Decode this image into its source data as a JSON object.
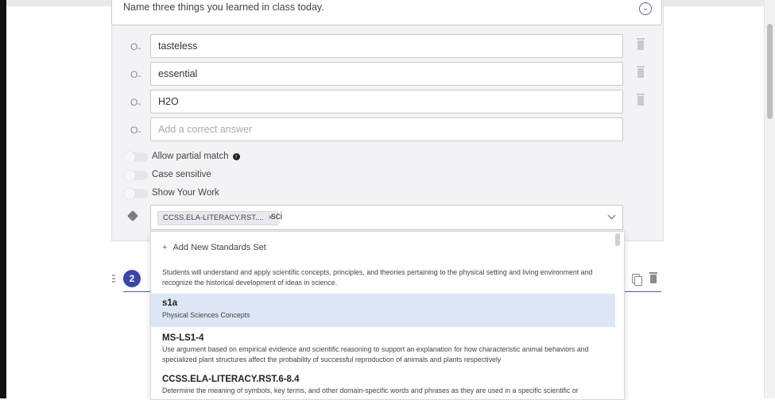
{
  "question": {
    "prompt_text": "Name three things you learned in class today.",
    "answers": [
      {
        "value": "tasteless"
      },
      {
        "value": "essential"
      },
      {
        "value": "H2O"
      }
    ],
    "new_answer_placeholder": "Add a correct answer",
    "options": [
      {
        "label": "Allow partial match",
        "enabled": false
      },
      {
        "label": "Case sensitive",
        "enabled": false
      },
      {
        "label": "Show Your Work",
        "enabled": false
      }
    ],
    "standards": {
      "selected_chip": "CCSS.ELA-LITERACY.RST....",
      "chip_remove_icon": "×",
      "search_query": "sci"
    }
  },
  "dropdown": {
    "add_new_label": "Add New Standards Set",
    "items": [
      {
        "code": "",
        "description": "Students will understand and apply scientific concepts, principles, and theories pertaining to the physical setting and living environment and recognize the historical development of ideas in science."
      },
      {
        "code": "s1a",
        "description": "Physical Sciences Concepts",
        "highlighted": true
      },
      {
        "code": "MS-LS1-4",
        "description": "Use argument based on empirical evidence and scientific reasoning to support an explanation for how characteristic animal behaviors and specialized plant structures affect the probability of successful reproduction of animals and plants respectively"
      },
      {
        "code": "CCSS.ELA-LITERACY.RST.6-8.4",
        "description": "Determine the meaning of symbols, key terms, and other domain-specific words and phrases as they are used in a specific scientific or"
      }
    ]
  },
  "next_question": {
    "number": "2"
  },
  "colors": {
    "accent": "#3b45a8",
    "highlight": "#dde6f5",
    "card_bg": "#f3f3f5"
  }
}
